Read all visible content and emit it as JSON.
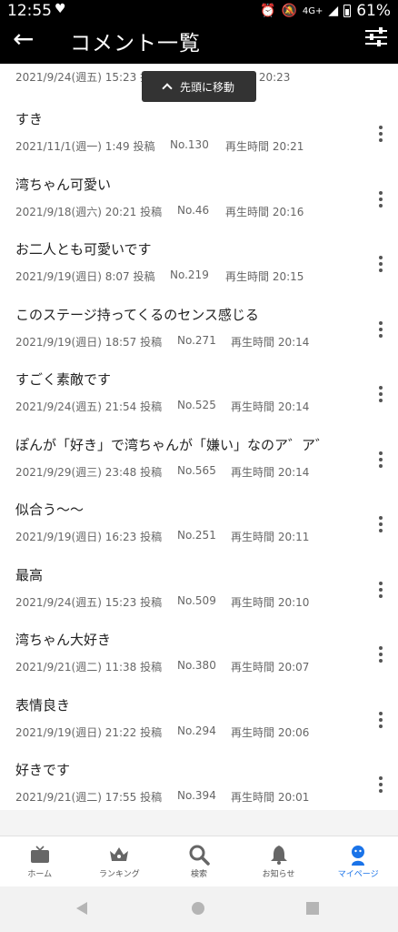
{
  "status": {
    "time": "12:55",
    "network": "4G+",
    "battery": "61%"
  },
  "appbar": {
    "title": "コメント一覧"
  },
  "jump_button": {
    "label": "先頭に移動"
  },
  "first_partial": {
    "posted": "2021/9/24(週五) 15:23 投稿",
    "play": "時間 20:23"
  },
  "comments": [
    {
      "text": "すき",
      "posted": "2021/11/1(週一) 1:49 投稿",
      "no": "No.130",
      "play": "再生時間 20:21"
    },
    {
      "text": "湾ちゃん可愛い",
      "posted": "2021/9/18(週六) 20:21 投稿",
      "no": "No.46",
      "play": "再生時間 20:16"
    },
    {
      "text": "お二人とも可愛いです",
      "posted": "2021/9/19(週日) 8:07 投稿",
      "no": "No.219",
      "play": "再生時間 20:15"
    },
    {
      "text": "このステージ持ってくるのセンス感じる",
      "posted": "2021/9/19(週日) 18:57 投稿",
      "no": "No.271",
      "play": "再生時間 20:14"
    },
    {
      "text": "すごく素敵です",
      "posted": "2021/9/24(週五) 21:54 投稿",
      "no": "No.525",
      "play": "再生時間 20:14"
    },
    {
      "text": "ぽんが「好き」で湾ちゃんが「嫌い」なのア゛ア゛",
      "posted": "2021/9/29(週三) 23:48 投稿",
      "no": "No.565",
      "play": "再生時間 20:14"
    },
    {
      "text": "似合う〜〜",
      "posted": "2021/9/19(週日) 16:23 投稿",
      "no": "No.251",
      "play": "再生時間 20:11"
    },
    {
      "text": "最高",
      "posted": "2021/9/24(週五) 15:23 投稿",
      "no": "No.509",
      "play": "再生時間 20:10"
    },
    {
      "text": "湾ちゃん大好き",
      "posted": "2021/9/21(週二) 11:38 投稿",
      "no": "No.380",
      "play": "再生時間 20:07"
    },
    {
      "text": "表情良き",
      "posted": "2021/9/19(週日) 21:22 投稿",
      "no": "No.294",
      "play": "再生時間 20:06"
    },
    {
      "text": "好きです",
      "posted": "2021/9/21(週二) 17:55 投稿",
      "no": "No.394",
      "play": "再生時間 20:01"
    }
  ],
  "tabs": [
    {
      "label": "ホーム",
      "icon": "tv-icon"
    },
    {
      "label": "ランキング",
      "icon": "crown-icon"
    },
    {
      "label": "検索",
      "icon": "search-icon"
    },
    {
      "label": "お知らせ",
      "icon": "bell-icon"
    },
    {
      "label": "マイページ",
      "icon": "person-icon",
      "active": true
    }
  ],
  "colors": {
    "accent": "#1a73e8",
    "appbar": "#000000",
    "toast": "#333333"
  }
}
